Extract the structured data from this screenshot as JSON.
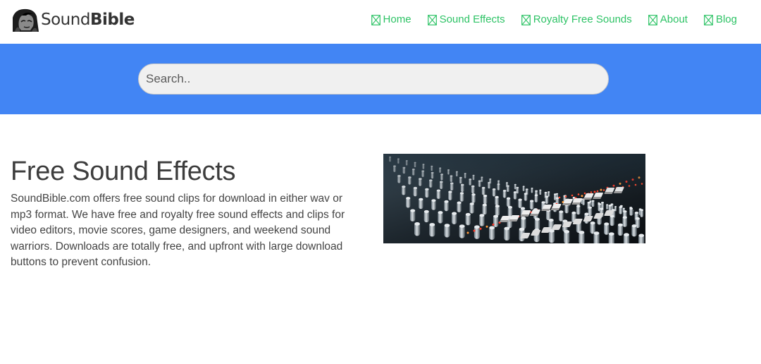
{
  "brand": {
    "name_light": "Sound",
    "name_bold": "Bible",
    "logo_icon": "portrait-logo-icon"
  },
  "nav": {
    "items": [
      {
        "label": "Home",
        "icon": "broken-image-icon"
      },
      {
        "label": "Sound Effects",
        "icon": "broken-image-icon"
      },
      {
        "label": "Royalty Free Sounds",
        "icon": "broken-image-icon"
      },
      {
        "label": "About",
        "icon": "broken-image-icon"
      },
      {
        "label": "Blog",
        "icon": "broken-image-icon"
      }
    ],
    "color": "#2ec366"
  },
  "search": {
    "placeholder": "Search..",
    "value": "",
    "band_color": "#4285f4"
  },
  "main": {
    "title": "Free Sound Effects",
    "description": "SoundBible.com offers free sound clips for download in either wav or mp3 format. We have free and royalty free sound effects and clips for video editors, movie scores, game designers, and weekend sound warriors. Downloads are totally free, and upfront with large download buttons to prevent confusion.",
    "hero_image": "mixing-console-photo"
  }
}
